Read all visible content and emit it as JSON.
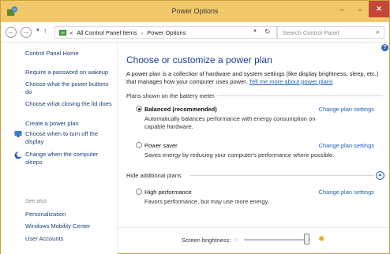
{
  "window": {
    "title": "Power Options",
    "minimize_glyph": "‒",
    "maximize_glyph": "▫",
    "close_glyph": "✕"
  },
  "address": {
    "crumb_prefix": "«",
    "crumb_1": "All Control Panel Items",
    "crumb_sep": "›",
    "crumb_2": "Power Options",
    "search_placeholder": "Search Control Panel"
  },
  "sidebar": {
    "home": "Control Panel Home",
    "link_1": "Require a password on wakeup",
    "link_2": "Choose what the power buttons do",
    "link_3": "Choose what closing the lid does",
    "link_4": "Create a power plan",
    "link_5": "Choose when to turn off the display",
    "link_6": "Change when the computer sleeps",
    "see_also": "See also",
    "also_1": "Personalization",
    "also_2": "Windows Mobility Center",
    "also_3": "User Accounts"
  },
  "main": {
    "heading": "Choose or customize a power plan",
    "intro_text": "A power plan is a collection of hardware and system settings (like display brightness, sleep, etc.) that manages how your computer uses power.",
    "intro_link": "Tell me more about power plans",
    "section_battery": "Plans shown on the battery meter",
    "section_hidden": "Hide additional plans",
    "change_label": "Change plan settings",
    "plans": [
      {
        "name": "Balanced (recommended)",
        "desc": "Automatically balances performance with energy consumption on capable hardware.",
        "selected": true
      },
      {
        "name": "Power saver",
        "desc": "Saves energy by reducing your computer's performance where possible.",
        "selected": false
      },
      {
        "name": "High performance",
        "desc": "Favors performance, but may use more energy.",
        "selected": false
      }
    ]
  },
  "brightness": {
    "label": "Screen brightness:",
    "level_percent": 95
  },
  "colors": {
    "titlebar": "#f1c86a",
    "link": "#1d5fb8",
    "heading": "#1b3f8d"
  }
}
